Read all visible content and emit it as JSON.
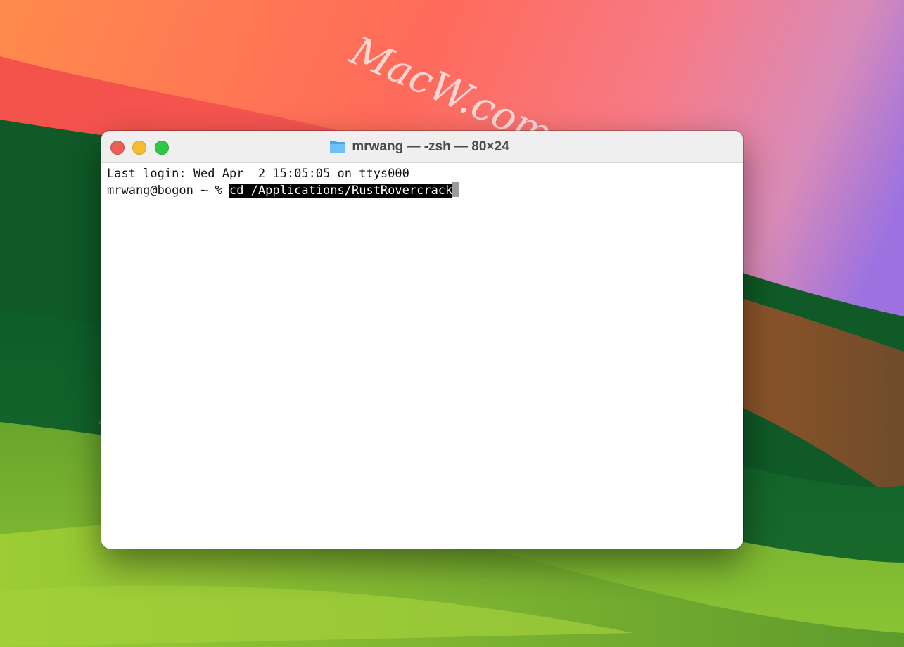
{
  "desktop": {
    "watermark_text": "MacW.com"
  },
  "window": {
    "title": "mrwang — -zsh — 80×24",
    "folder_icon": "folder-icon",
    "controls": {
      "close": "close-button",
      "minimize": "minimize-button",
      "zoom": "zoom-button"
    }
  },
  "terminal": {
    "last_login": "Last login: Wed Apr  2 15:05:05 on ttys000",
    "prompt": "mrwang@bogon ~ % ",
    "command": "cd /Applications/RustRovercrack"
  }
}
